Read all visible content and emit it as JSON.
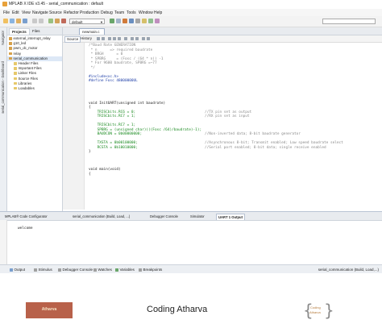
{
  "window": {
    "title": "MPLAB X IDE v3.45 - serial_communication : default"
  },
  "menu": [
    "File",
    "Edit",
    "View",
    "Navigate",
    "Source",
    "Refactor",
    "Production",
    "Debug",
    "Team",
    "Tools",
    "Window",
    "Help"
  ],
  "toolbar": {
    "config_value": "default"
  },
  "left_tabs": [
    "Navigator",
    "serial_communication - Dashboard"
  ],
  "projects": {
    "tabs": [
      "Projects",
      "Files"
    ],
    "items": [
      "external_interrupt_relay",
      "g10_led",
      "pwm_dc_motor",
      "relay",
      "serial_communication",
      "Header Files",
      "Important Files",
      "Linker Files",
      "Source Files",
      "Libraries",
      "Loadables"
    ]
  },
  "editor": {
    "side_tab": "Source",
    "history_tab": "History",
    "file_tab": "newmain.c",
    "lines": [
      "/*Baud Rate GENERATION",
      " * n      => required baudrate",
      " * BRGH      = 0",
      " * SPBRG     = (Fosc / (64 * n)) -1",
      " * For 9600 baudrate, SPBRG =~77",
      " */",
      "",
      "#include<xc.h>",
      "#define Fosc 48000000UL",
      "",
      "",
      "",
      "",
      "void InitUART(unsigned int baudrate)",
      "{",
      "    TRISCbits.RC6 = 0;",
      "    TRISCbits.RC7 = 1;",
      "",
      "    TRISCbits.RC7 = 1;",
      "    SPBRG = (unsigned char)(((Fosc /64)/baudrate)-1);",
      "    BAUDCON = 0b00000000;",
      "",
      "    TXSTA = 0b00100000;",
      "    RCSTA = 0b10010000;",
      "}",
      "",
      "",
      "",
      "void main(void)",
      "{"
    ],
    "comments": {
      "c15": "//TX pin set as output",
      "c16": "//RX pin set as input",
      "c20": "//Non-inverted data; 8-bit baudrate generator",
      "c22": "//Asynchronous 8-bit; Transmit enabled; Low speed baudrate select",
      "c23": "//Serial port enabled; 8-bit data; single receive enabled"
    }
  },
  "output": {
    "tabs": [
      "MPLAB® Code Configurator",
      "serial_communication (Build, Load, ...)",
      "Debugger Console",
      "Simulator",
      "UART 1 Output"
    ],
    "text": "welcome"
  },
  "bottom_tabs": [
    "Output",
    "Stimulus",
    "Debugger Console",
    "Watches",
    "Variables",
    "Breakpoints"
  ],
  "status": "serial_communication (Build, Load,...)",
  "footer": {
    "left_logo_text": "Atharva",
    "brand": "Coding Atharva",
    "right_logo_line1": "Coding",
    "right_logo_line2": "Atharva"
  }
}
